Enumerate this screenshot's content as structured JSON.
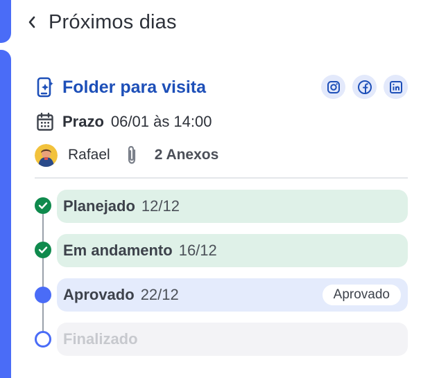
{
  "header": {
    "title": "Próximos dias",
    "back_icon": "chevron-left-icon"
  },
  "colors": {
    "accent": "#4a6cf7",
    "title_blue": "#1d4fb8",
    "done_green": "#0f8a4d"
  },
  "task": {
    "icon": "mobile-sparkle-icon",
    "title": "Folder para visita",
    "social": [
      "instagram-icon",
      "facebook-icon",
      "linkedin-icon"
    ],
    "due_label": "Prazo",
    "due_value": "06/01 às 14:00",
    "assignee": "Rafael",
    "attachments": "2 Anexos"
  },
  "steps": [
    {
      "name": "Planejado",
      "date": "12/12",
      "status": "done"
    },
    {
      "name": "Em andamento",
      "date": "16/12",
      "status": "done"
    },
    {
      "name": "Aprovado",
      "date": "22/12",
      "status": "active",
      "badge": "Aprovado"
    },
    {
      "name": "Finalizado",
      "date": "",
      "status": "pending"
    }
  ]
}
